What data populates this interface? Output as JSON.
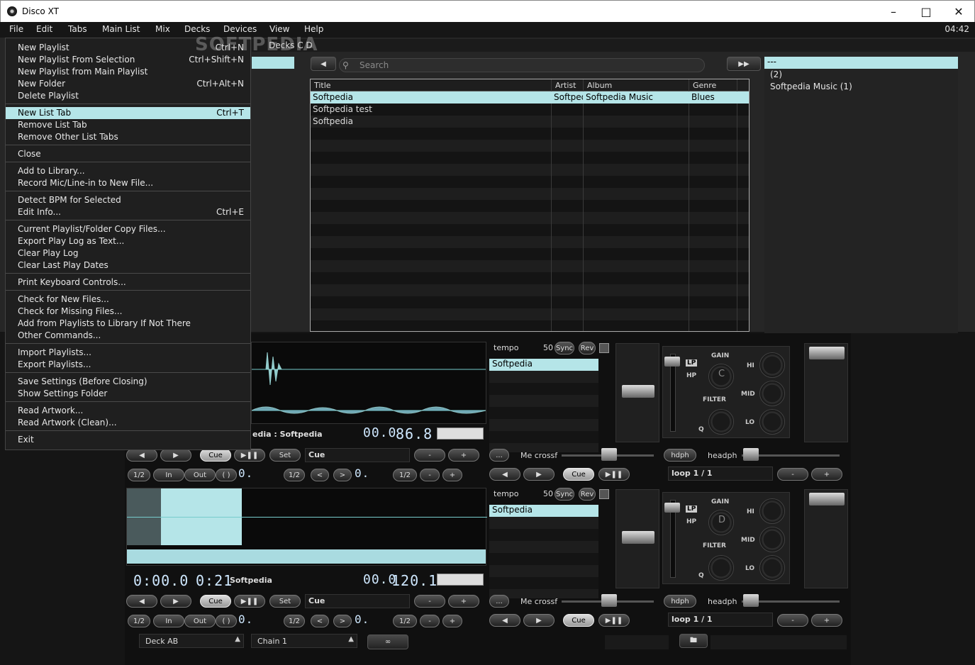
{
  "window": {
    "title": "Disco XT",
    "clock": "04:42"
  },
  "menubar": [
    "File",
    "Edit",
    "Tabs",
    "Main List",
    "Mix",
    "Decks",
    "Devices",
    "View",
    "Help"
  ],
  "tabs": {
    "decks": "Decks C D"
  },
  "search": {
    "placeholder": "Search"
  },
  "table": {
    "columns": [
      "Title",
      "Artist",
      "Album",
      "Genre"
    ],
    "rows": [
      {
        "title": "Softpedia",
        "artist": "Softpedia",
        "album": "Softpedia Music",
        "genre": "Blues",
        "selected": true
      },
      {
        "title": "Softpedia test",
        "artist": "",
        "album": "",
        "genre": "",
        "selected": false
      },
      {
        "title": "Softpedia",
        "artist": "",
        "album": "",
        "genre": "",
        "selected": false
      }
    ]
  },
  "right_panel": {
    "header": "---",
    "items": [
      "(2)",
      "Softpedia Music (1)"
    ]
  },
  "file_menu": [
    {
      "label": "New Playlist",
      "shortcut": "Ctrl+N"
    },
    {
      "label": "New Playlist From Selection",
      "shortcut": "Ctrl+Shift+N"
    },
    {
      "label": "New Playlist from Main Playlist",
      "shortcut": ""
    },
    {
      "label": "New Folder",
      "shortcut": "Ctrl+Alt+N"
    },
    {
      "label": "Delete Playlist",
      "shortcut": ""
    },
    {
      "label": "New List Tab",
      "shortcut": "Ctrl+T",
      "highlighted": true
    },
    {
      "label": "Remove List Tab",
      "shortcut": ""
    },
    {
      "label": "Remove Other List Tabs",
      "shortcut": ""
    },
    {
      "label": "Close",
      "shortcut": ""
    },
    {
      "label": "Add to Library...",
      "shortcut": ""
    },
    {
      "label": "Record Mic/Line-in to New File...",
      "shortcut": ""
    },
    {
      "label": "Detect BPM for Selected",
      "shortcut": ""
    },
    {
      "label": "Edit Info...",
      "shortcut": "Ctrl+E"
    },
    {
      "label": "Current Playlist/Folder Copy Files...",
      "shortcut": ""
    },
    {
      "label": "Export Play Log as Text...",
      "shortcut": ""
    },
    {
      "label": "Clear Play Log",
      "shortcut": ""
    },
    {
      "label": "Clear Last Play Dates",
      "shortcut": ""
    },
    {
      "label": "Print Keyboard Controls...",
      "shortcut": ""
    },
    {
      "label": "Check for New Files...",
      "shortcut": ""
    },
    {
      "label": "Check for Missing Files...",
      "shortcut": ""
    },
    {
      "label": "Add from Playlists to Library If Not There",
      "shortcut": ""
    },
    {
      "label": "Other Commands...",
      "shortcut": ""
    },
    {
      "label": "Import Playlists...",
      "shortcut": ""
    },
    {
      "label": "Export Playlists...",
      "shortcut": ""
    },
    {
      "label": "Save Settings (Before Closing)",
      "shortcut": ""
    },
    {
      "label": "Show Settings Folder",
      "shortcut": ""
    },
    {
      "label": "Read Artwork...",
      "shortcut": ""
    },
    {
      "label": "Read Artwork (Clean)...",
      "shortcut": ""
    },
    {
      "label": "Exit",
      "shortcut": ""
    }
  ],
  "deck_c": {
    "track_label": "edia : Softpedia",
    "pitch": "00.0",
    "bpm": "86.8",
    "tempo_label": "tempo",
    "tempo_value": "50",
    "sync": "Sync",
    "rev": "Rev",
    "list_item": "Softpedia",
    "filter_letter": "C"
  },
  "deck_d": {
    "time_elapsed": "0:00.0",
    "time_remaining": "0:21",
    "track_label": "Softpedia",
    "pitch": "00.0",
    "bpm": "120.1",
    "tempo_label": "tempo",
    "tempo_value": "50",
    "sync": "Sync",
    "rev": "Rev",
    "list_item": "Softpedia",
    "filter_letter": "D"
  },
  "controls": {
    "cue": "Cue",
    "set": "Set",
    "cue_field": "Cue",
    "half": "1/2",
    "in": "In",
    "out": "Out",
    "loop_paren": "( )",
    "zero": "0.",
    "lt": "<",
    "gt": ">",
    "minus": "-",
    "plus": "+",
    "dots": "...",
    "crossf": "Me crossf",
    "hdph": "hdph",
    "headph": "headph",
    "loop": "loop 1 / 1",
    "gain": "GAIN",
    "filter": "FILTER",
    "hi": "HI",
    "mid": "MID",
    "lo": "LO",
    "lp": "LP",
    "hp": "HP",
    "q": "Q"
  },
  "bottom": {
    "deck_select": "Deck AB",
    "chain_select": "Chain 1"
  },
  "watermark": "SOFTPEDIA",
  "colors": {
    "highlight": "#b5e5e8",
    "background": "#151515"
  }
}
